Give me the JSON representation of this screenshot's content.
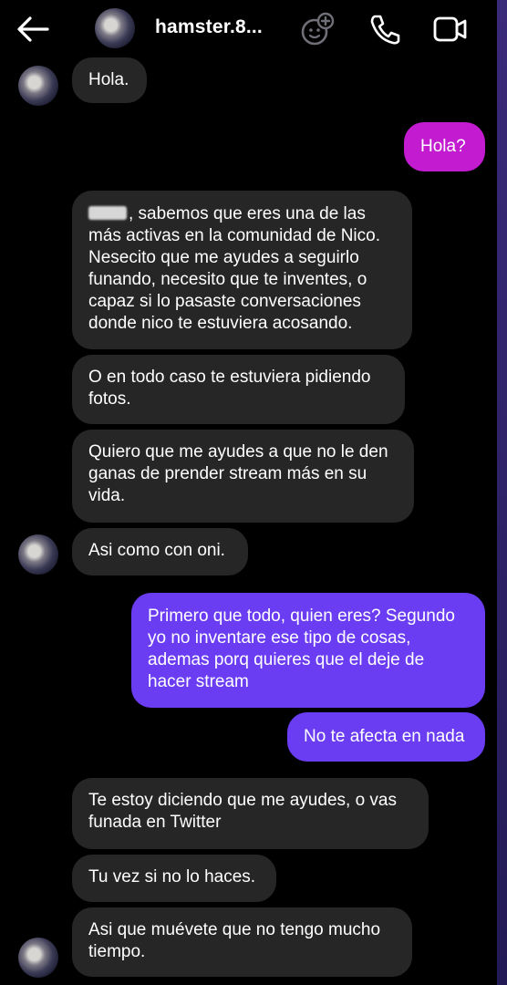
{
  "header": {
    "username": "hamster.8...",
    "icons": [
      "back-arrow-icon",
      "effects-icon",
      "phone-icon",
      "video-camera-icon"
    ]
  },
  "messages": [
    {
      "side": "in",
      "text": "Hola."
    },
    {
      "side": "out",
      "text": "Hola?"
    },
    {
      "side": "in",
      "text": ", sabemos que eres una de las más activas en la comunidad de Nico. Nesecito que me ayudes a seguirlo funando, necesito que te inventes, o capaz si lo pasaste conversaciones donde nico te estuviera acosando."
    },
    {
      "side": "in",
      "text": "O en todo caso te estuviera pidiendo fotos."
    },
    {
      "side": "in",
      "text": "Quiero que me ayudes a que no le den ganas de prender stream más en su vida."
    },
    {
      "side": "in",
      "text": "Asi como con oni."
    },
    {
      "side": "out",
      "text": "Primero que todo, quien eres? Segundo yo no inventare ese tipo de cosas, ademas porq quieres que el deje de hacer stream"
    },
    {
      "side": "out",
      "text": "No te afecta en nada"
    },
    {
      "side": "in",
      "text": "Te estoy diciendo que me ayudes, o vas funada en Twitter"
    },
    {
      "side": "in",
      "text": "Tu vez si no lo haces."
    },
    {
      "side": "in",
      "text": "Asi que muévete que no tengo mucho tiempo."
    }
  ],
  "colors": {
    "background": "#000000",
    "incoming_bubble": "#262626",
    "outgoing_pink": "#c21bd0",
    "outgoing_violet": "#6a3cf2"
  }
}
